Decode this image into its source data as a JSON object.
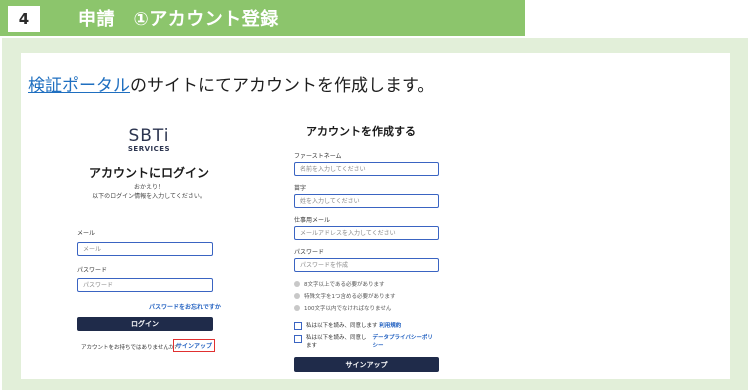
{
  "header": {
    "step_number": "4",
    "title": "申請　①アカウント登録"
  },
  "intro": {
    "link_text": "検証ポータル",
    "rest_text": "のサイトにてアカウントを作成します。"
  },
  "login": {
    "logo_main": "SBTi",
    "logo_sub": "SERVICES",
    "title": "アカウントにログイン",
    "welcome_line1": "おかえり！",
    "welcome_line2": "以下のログイン情報を入力してください。",
    "email_label": "メール",
    "email_placeholder": "メール",
    "password_label": "パスワード",
    "password_placeholder": "パスワード",
    "forgot_link": "パスワードをお忘れですか",
    "login_button": "ログイン",
    "no_account_text": "アカウントをお持ちではありませんか?",
    "signup_link": "サインアップ"
  },
  "signup": {
    "title": "アカウントを作成する",
    "first_name_label": "ファーストネーム",
    "first_name_placeholder": "名前を入力してください",
    "last_name_label": "苗字",
    "last_name_placeholder": "姓を入力してください",
    "email_label": "仕事用メール",
    "email_placeholder": "メールアドレスを入力してください",
    "password_label": "パスワード",
    "password_placeholder": "パスワードを作成",
    "requirements": [
      "8文字以上である必要があります",
      "特殊文字を1つ含める必要があります",
      "100文字以内でなければなりません"
    ],
    "terms_prefix": "私は以下を読み、同意します",
    "terms_link": "利用規約",
    "privacy_prefix": "私は以下を読み、同意し",
    "privacy_suffix": "ます",
    "privacy_link": "データプライバシーポリシー",
    "signup_button": "サインアップ"
  }
}
